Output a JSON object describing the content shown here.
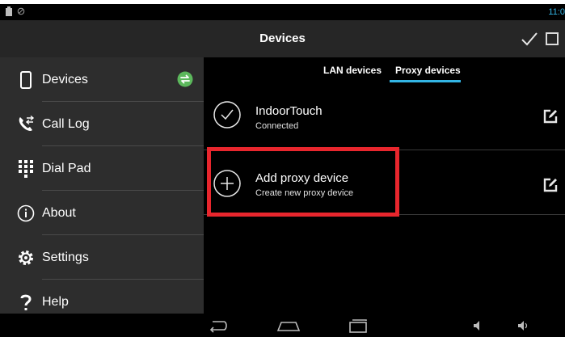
{
  "status_bar": {
    "time": "11:0",
    "left_icons": [
      "battery-icon",
      "no-signal-icon"
    ]
  },
  "action_bar": {
    "title": "Devices",
    "actions": [
      "check-icon",
      "select-all-checkbox-icon"
    ]
  },
  "sidebar": {
    "items": [
      {
        "label": "Devices",
        "icon": "phone-icon",
        "badge_icon": "sync-icon"
      },
      {
        "label": "Call Log",
        "icon": "call-log-icon"
      },
      {
        "label": "Dial Pad",
        "icon": "dialpad-icon"
      },
      {
        "label": "About",
        "icon": "info-icon"
      },
      {
        "label": "Settings",
        "icon": "gear-icon"
      },
      {
        "label": "Help",
        "icon": "question-icon"
      }
    ]
  },
  "tabs": [
    {
      "label": "LAN devices",
      "selected": false
    },
    {
      "label": "Proxy devices",
      "selected": true
    }
  ],
  "devices": [
    {
      "name": "IndoorTouch",
      "status": "Connected",
      "icon": "check-circle-icon",
      "action_icon": "edit-icon"
    },
    {
      "name": "Add proxy device",
      "status": "Create new proxy device",
      "icon": "add-circle-icon",
      "action_icon": "edit-icon"
    }
  ],
  "navigation_bar": [
    "back-icon",
    "home-icon",
    "recent-apps-icon",
    "volume-down-icon",
    "volume-up-icon"
  ],
  "colors": {
    "accent": "#33b5e5",
    "highlight": "#e8262d",
    "sync_badge": "#5cb85c",
    "sidebar_bg": "#2d2d2d",
    "action_bar_bg": "#262626"
  }
}
